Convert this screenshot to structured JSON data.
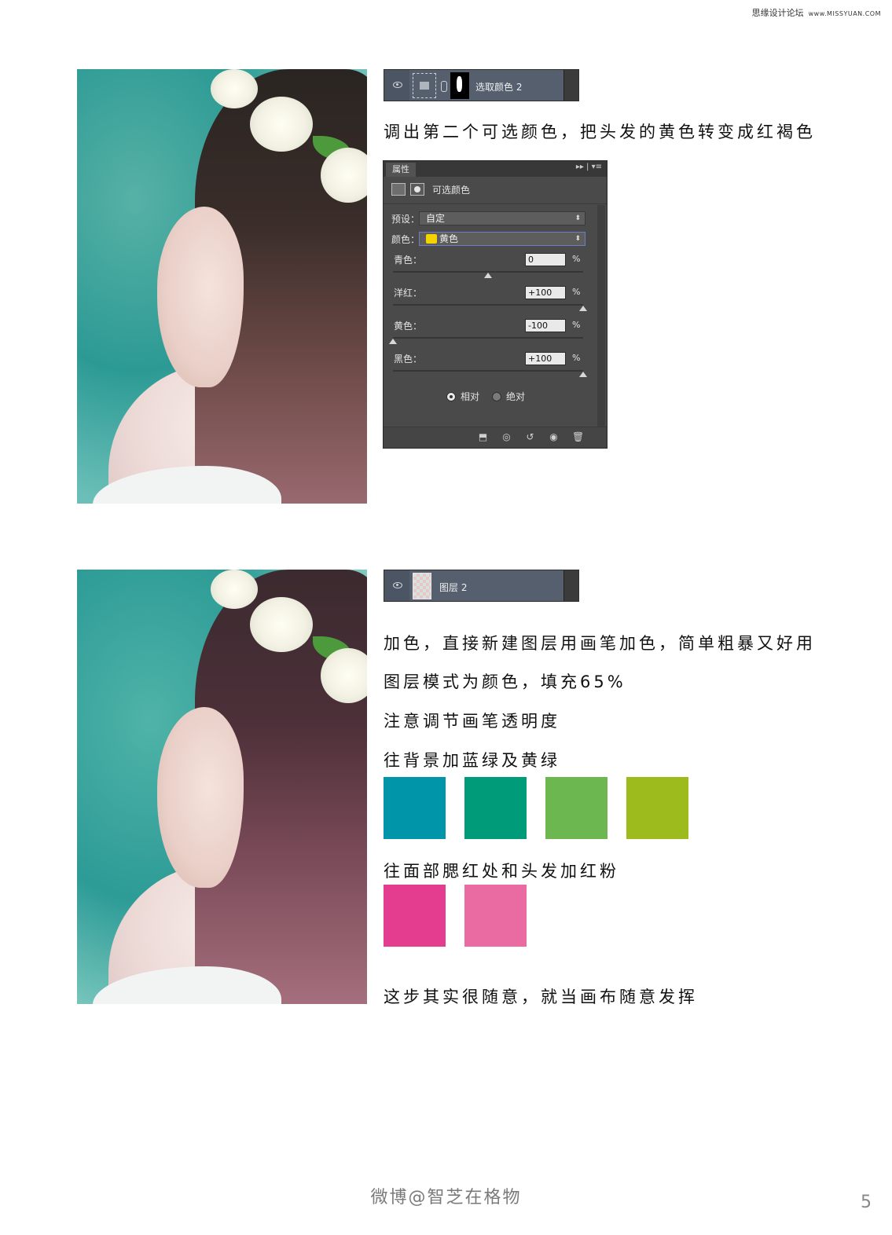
{
  "site_mark": {
    "name": "思缘设计论坛",
    "url": "www.MISSYUAN.COM"
  },
  "section1": {
    "layer_name": "选取颜色 2",
    "caption": "调出第二个可选颜色，把头发的黄色转变成红褐色",
    "panel": {
      "tab": "属性",
      "title": "可选颜色",
      "preset_label": "预设：",
      "preset_value": "自定",
      "colors_label": "颜色：",
      "colors_value": "黄色",
      "sliders": [
        {
          "label": "青色：",
          "value": "0",
          "unit": "%",
          "level": 0.5
        },
        {
          "label": "洋红：",
          "value": "+100",
          "unit": "%",
          "level": 1.0
        },
        {
          "label": "黄色：",
          "value": "-100",
          "unit": "%",
          "level": 0.0
        },
        {
          "label": "黑色：",
          "value": "+100",
          "unit": "%",
          "level": 1.0
        }
      ],
      "method_relative": "相对",
      "method_absolute": "绝对",
      "selected_method": "relative"
    }
  },
  "section2": {
    "layer_name": "图层 2",
    "lines": [
      "加色，直接新建图层用画笔加色，简单粗暴又好用",
      "图层模式为颜色，填充65%",
      "注意调节画笔透明度",
      "往背景加蓝绿及黄绿"
    ],
    "bg_swatches": [
      "#0095a8",
      "#009b78",
      "#6cb74f",
      "#9ebb1d"
    ],
    "face_caption": "往面部腮红处和头发加红粉",
    "face_swatches": [
      "#e43c8f",
      "#ea6aa2"
    ],
    "closing": "这步其实很随意，就当画布随意发挥"
  },
  "footer": {
    "credit": "微博@智芝在格物",
    "page": "5"
  }
}
